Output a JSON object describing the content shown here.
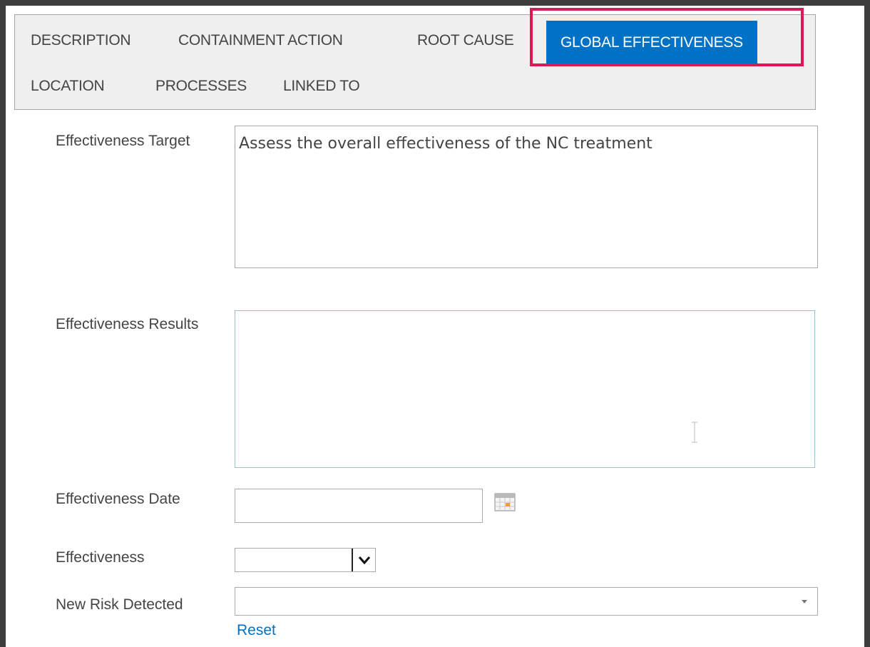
{
  "tabs": [
    {
      "label": "DESCRIPTION",
      "active": false
    },
    {
      "label": "CONTAINMENT ACTION",
      "active": false
    },
    {
      "label": "ROOT CAUSE",
      "active": false
    },
    {
      "label": "GLOBAL EFFECTIVENESS",
      "active": true
    },
    {
      "label": "LOCATION",
      "active": false
    },
    {
      "label": "PROCESSES",
      "active": false
    },
    {
      "label": "LINKED TO",
      "active": false
    }
  ],
  "form": {
    "effectiveness_target": {
      "label": "Effectiveness Target",
      "value": "Assess the overall effectiveness of the NC treatment"
    },
    "effectiveness_results": {
      "label": "Effectiveness Results",
      "value": ""
    },
    "effectiveness_date": {
      "label": "Effectiveness Date",
      "value": ""
    },
    "effectiveness": {
      "label": "Effectiveness",
      "value": ""
    },
    "new_risk_detected": {
      "label": "New Risk Detected",
      "value": ""
    },
    "reset_label": "Reset"
  },
  "colors": {
    "accent": "#0072c6",
    "highlight": "#d81b55",
    "tabbar_bg": "#efefef",
    "text": "#444444"
  },
  "icons": {
    "calendar": "calendar-icon",
    "dropdown": "chevron-down-icon",
    "combo_arrow": "caret-down-icon",
    "text_cursor": "text-cursor-icon"
  }
}
